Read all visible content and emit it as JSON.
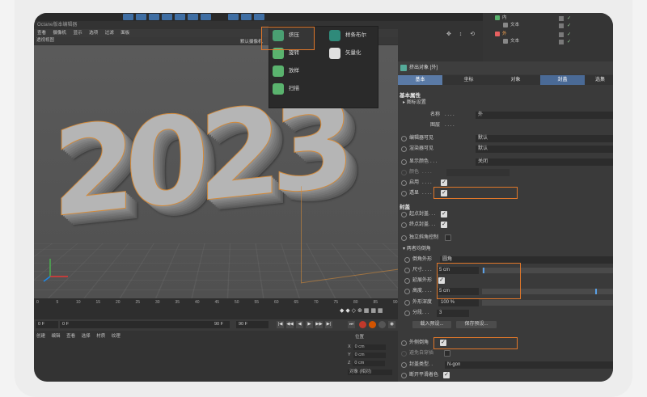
{
  "titlebar": {
    "title": "Octane版本编辑器"
  },
  "menubar": {
    "items": [
      "查看",
      "摄像机",
      "显示",
      "选项",
      "过滤",
      "面板"
    ]
  },
  "viewport": {
    "label": "透视视图",
    "camera": "默认摄像机",
    "big_text": "2023"
  },
  "popup": {
    "items": [
      "挤压",
      "旋转",
      "放样",
      "扫描",
      "样条布尔",
      "矢量化"
    ]
  },
  "objects": {
    "rows": [
      {
        "name": "内"
      },
      {
        "name": "文本"
      },
      {
        "name": "外"
      },
      {
        "name": "文本"
      }
    ]
  },
  "timeline": {
    "ticks": [
      "0",
      "5",
      "10",
      "15",
      "20",
      "25",
      "30",
      "35",
      "40",
      "45",
      "50",
      "55",
      "60",
      "65",
      "70",
      "75",
      "80",
      "85",
      "90"
    ]
  },
  "playback": {
    "current_frame": "0 F",
    "start_frame": "0 F",
    "end_frame": "90 F",
    "max_frame": "90 F"
  },
  "materials": {
    "menu": [
      "创建",
      "编辑",
      "查看",
      "选择",
      "材质",
      "纹理"
    ]
  },
  "coords": {
    "header": "位置",
    "x": "0 cm",
    "y": "0 cm",
    "z": "0 cm",
    "mode": "对象 (相对)"
  },
  "attributes": {
    "header": "挤出对象 [外]",
    "tabs": [
      "基本",
      "坐标",
      "对象",
      "封盖",
      "选集"
    ],
    "section_basic": "基本属性",
    "icon_settings": "图标设置",
    "name_label": "名称",
    "name_value": "外",
    "layer_label": "图层",
    "editor_visible_label": "编辑器可见",
    "editor_visible_value": "默认",
    "render_visible_label": "渲染器可见",
    "render_visible_value": "默认",
    "display_color_label": "显示颜色",
    "display_color_value": "关闭",
    "color_label": "颜色",
    "enable_label": "启用",
    "xray_label": "透显",
    "section_caps": "封盖",
    "start_cap_label": "起点封盖",
    "end_cap_label": "终点封盖",
    "independent_fillet_label": "独立斜角控制",
    "both_fillet_label": "两者均倒角",
    "fillet_shape_label": "倒角外形",
    "fillet_shape_value": "圆角",
    "size_label": "尺寸",
    "size_value": "5 cm",
    "extend_shape_label": "延展外形",
    "height_label": "高度",
    "height_value": "5 cm",
    "shape_depth_label": "外形深度",
    "shape_depth_value": "100 %",
    "segments_label": "分段",
    "segments_value": "3",
    "load_preset": "载入预设...",
    "save_preset": "保存预设...",
    "outer_fillet_label": "外侧倒角",
    "avoid_intersect_label": "避免自穿插",
    "cap_type_label": "封盖类型",
    "cap_type_value": "N-gon",
    "break_phong_label": "断开平滑着色"
  }
}
